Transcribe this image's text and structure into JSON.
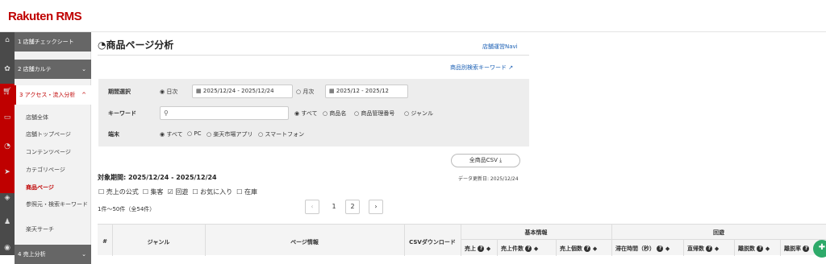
{
  "app": {
    "logo": "Rakuten RMS"
  },
  "sidebar": {
    "icons": [
      "home-icon",
      "gear-icon",
      "cart-icon",
      "layers-icon",
      "pie-icon",
      "send-icon",
      "tag-icon",
      "people-icon",
      "coin-icon"
    ],
    "sections": [
      {
        "label": "1 店舗チェックシート",
        "chev": ""
      },
      {
        "label": "2 店舗カルテ",
        "chev": "⌄"
      },
      {
        "label": "3 アクセス・流入分析",
        "chev": "^"
      },
      {
        "label": "4 売上分析",
        "chev": "⌄"
      }
    ],
    "subitems": [
      "店舗全体",
      "店舗トップページ",
      "コンテンツページ",
      "カテゴリページ",
      "商品ページ",
      "参照元・検索キーワード",
      "楽天サーチ"
    ]
  },
  "main": {
    "title": "商品ページ分析",
    "navi_link": "店舗運営Navi",
    "keyword_link": "商品別検索キーワード",
    "filters": {
      "period_label": "期間選択",
      "daily": "日次",
      "daily_range": "2025/12/24 - 2025/12/24",
      "monthly": "月次",
      "monthly_range": "2025/12 - 2025/12",
      "keyword_label": "キーワード",
      "kw_all": "すべて",
      "kw_name": "商品名",
      "kw_number": "商品管理番号",
      "kw_genre": "ジャンル",
      "device_label": "端末",
      "dev_all": "すべて",
      "dev_pc": "PC",
      "dev_app": "楽天市場アプリ",
      "dev_sp": "スマートフォン"
    },
    "csv_button": "全商品CSV",
    "period_text": "対象期間: 2025/12/24 - 2025/12/24",
    "updated_text": "データ更新日: 2025/12/24",
    "checks": [
      {
        "label": "売上の公式",
        "checked": false
      },
      {
        "label": "集客",
        "checked": false
      },
      {
        "label": "回遊",
        "checked": true
      },
      {
        "label": "お気に入り",
        "checked": false
      },
      {
        "label": "在庫",
        "checked": false
      }
    ],
    "count_text": "1件〜50件（全54件）",
    "pager": {
      "page1": "1",
      "page2": "2"
    },
    "table": {
      "col_num": "#",
      "col_genre": "ジャンル",
      "col_page": "ページ情報",
      "col_csv": "CSVダウンロード",
      "group_basic": "基本情報",
      "group_kaiyu": "回遊",
      "sub": [
        "売上",
        "売上件数",
        "売上個数",
        "滞在時間（秒）",
        "直帰数",
        "離脱数",
        "離脱率"
      ]
    }
  }
}
